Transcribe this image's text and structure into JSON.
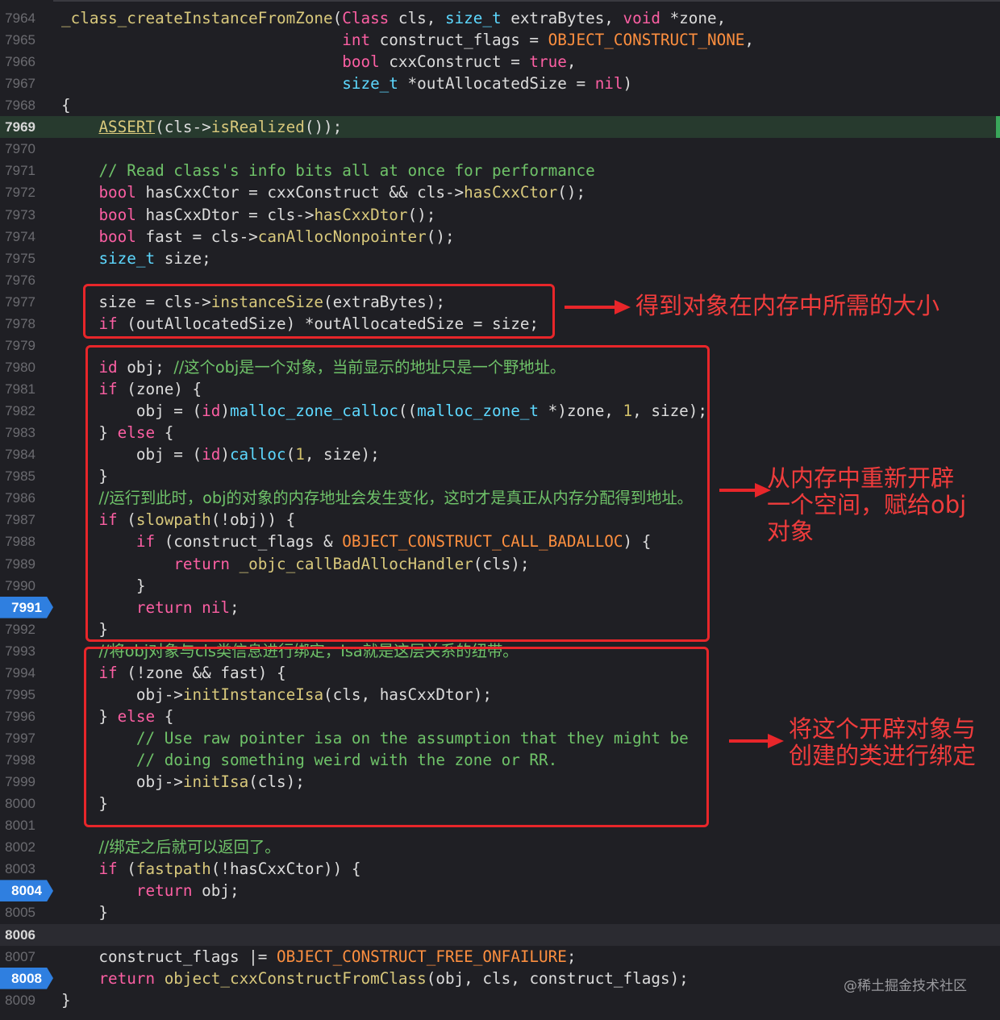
{
  "editor": {
    "lines": [
      {
        "n": "7964",
        "segs": [
          [
            "fn",
            "_class_createInstanceFromZone"
          ],
          [
            "pl",
            "("
          ],
          [
            "kw",
            "Class"
          ],
          [
            "pl",
            " cls, "
          ],
          [
            "ty",
            "size_t"
          ],
          [
            "pl",
            " extraBytes, "
          ],
          [
            "kw",
            "void"
          ],
          [
            "pl",
            " *zone,"
          ]
        ]
      },
      {
        "n": "7965",
        "segs": [
          [
            "pl",
            "                              "
          ],
          [
            "kw",
            "int"
          ],
          [
            "pl",
            " construct_flags = "
          ],
          [
            "mac",
            "OBJECT_CONSTRUCT_NONE"
          ],
          [
            "pl",
            ","
          ]
        ]
      },
      {
        "n": "7966",
        "segs": [
          [
            "pl",
            "                              "
          ],
          [
            "kw",
            "bool"
          ],
          [
            "pl",
            " cxxConstruct = "
          ],
          [
            "kw",
            "true"
          ],
          [
            "pl",
            ","
          ]
        ]
      },
      {
        "n": "7967",
        "segs": [
          [
            "pl",
            "                              "
          ],
          [
            "ty",
            "size_t"
          ],
          [
            "pl",
            " *outAllocatedSize = "
          ],
          [
            "kw",
            "nil"
          ],
          [
            "pl",
            ")"
          ]
        ]
      },
      {
        "n": "7968",
        "segs": [
          [
            "pl",
            "{"
          ]
        ]
      },
      {
        "n": "7969",
        "hl": "green",
        "cur": true,
        "segs": [
          [
            "pl",
            "    "
          ],
          [
            "fn ul",
            "ASSERT"
          ],
          [
            "pl",
            "(cls->"
          ],
          [
            "fn",
            "isRealized"
          ],
          [
            "pl",
            "());"
          ]
        ]
      },
      {
        "n": "7970",
        "segs": []
      },
      {
        "n": "7971",
        "segs": [
          [
            "pl",
            "    "
          ],
          [
            "cm",
            "// Read class's info bits all at once for performance"
          ]
        ]
      },
      {
        "n": "7972",
        "segs": [
          [
            "pl",
            "    "
          ],
          [
            "kw",
            "bool"
          ],
          [
            "pl",
            " hasCxxCtor = cxxConstruct && cls->"
          ],
          [
            "fn",
            "hasCxxCtor"
          ],
          [
            "pl",
            "();"
          ]
        ]
      },
      {
        "n": "7973",
        "segs": [
          [
            "pl",
            "    "
          ],
          [
            "kw",
            "bool"
          ],
          [
            "pl",
            " hasCxxDtor = cls->"
          ],
          [
            "fn",
            "hasCxxDtor"
          ],
          [
            "pl",
            "();"
          ]
        ]
      },
      {
        "n": "7974",
        "segs": [
          [
            "pl",
            "    "
          ],
          [
            "kw",
            "bool"
          ],
          [
            "pl",
            " fast = cls->"
          ],
          [
            "fn",
            "canAllocNonpointer"
          ],
          [
            "pl",
            "();"
          ]
        ]
      },
      {
        "n": "7975",
        "segs": [
          [
            "pl",
            "    "
          ],
          [
            "ty",
            "size_t"
          ],
          [
            "pl",
            " size;"
          ]
        ]
      },
      {
        "n": "7976",
        "segs": []
      },
      {
        "n": "7977",
        "segs": [
          [
            "pl",
            "    size = cls->"
          ],
          [
            "fn",
            "instanceSize"
          ],
          [
            "pl",
            "(extraBytes);"
          ]
        ]
      },
      {
        "n": "7978",
        "segs": [
          [
            "pl",
            "    "
          ],
          [
            "kw",
            "if"
          ],
          [
            "pl",
            " (outAllocatedSize) *outAllocatedSize = size;"
          ]
        ]
      },
      {
        "n": "7979",
        "segs": []
      },
      {
        "n": "7980",
        "segs": [
          [
            "pl",
            "    "
          ],
          [
            "kw",
            "id"
          ],
          [
            "pl",
            " obj; "
          ],
          [
            "cmc",
            "//这个obj是一个对象，当前显示的地址只是一个野地址。"
          ]
        ]
      },
      {
        "n": "7981",
        "segs": [
          [
            "pl",
            "    "
          ],
          [
            "kw",
            "if"
          ],
          [
            "pl",
            " (zone) {"
          ]
        ]
      },
      {
        "n": "7982",
        "segs": [
          [
            "pl",
            "        obj = ("
          ],
          [
            "kw",
            "id"
          ],
          [
            "pl",
            ")"
          ],
          [
            "ty",
            "malloc_zone_calloc"
          ],
          [
            "pl",
            "(("
          ],
          [
            "ty",
            "malloc_zone_t"
          ],
          [
            "pl",
            " *)zone, "
          ],
          [
            "num",
            "1"
          ],
          [
            "pl",
            ", size);"
          ]
        ]
      },
      {
        "n": "7983",
        "segs": [
          [
            "pl",
            "    } "
          ],
          [
            "kw",
            "else"
          ],
          [
            "pl",
            " {"
          ]
        ]
      },
      {
        "n": "7984",
        "segs": [
          [
            "pl",
            "        obj = ("
          ],
          [
            "kw",
            "id"
          ],
          [
            "pl",
            ")"
          ],
          [
            "ty",
            "calloc"
          ],
          [
            "pl",
            "("
          ],
          [
            "num",
            "1"
          ],
          [
            "pl",
            ", size);"
          ]
        ]
      },
      {
        "n": "7985",
        "segs": [
          [
            "pl",
            "    }"
          ]
        ]
      },
      {
        "n": "7986",
        "segs": [
          [
            "pl",
            "    "
          ],
          [
            "cmc",
            "//运行到此时，obj的对象的内存地址会发生变化，这时才是真正从内存分配得到地址。"
          ]
        ]
      },
      {
        "n": "7987",
        "segs": [
          [
            "pl",
            "    "
          ],
          [
            "kw",
            "if"
          ],
          [
            "pl",
            " ("
          ],
          [
            "fn",
            "slowpath"
          ],
          [
            "pl",
            "(!obj)) {"
          ]
        ]
      },
      {
        "n": "7988",
        "segs": [
          [
            "pl",
            "        "
          ],
          [
            "kw",
            "if"
          ],
          [
            "pl",
            " (construct_flags & "
          ],
          [
            "mac",
            "OBJECT_CONSTRUCT_CALL_BADALLOC"
          ],
          [
            "pl",
            ") {"
          ]
        ]
      },
      {
        "n": "7989",
        "segs": [
          [
            "pl",
            "            "
          ],
          [
            "kw",
            "return"
          ],
          [
            "pl",
            " "
          ],
          [
            "fn",
            "_objc_callBadAllocHandler"
          ],
          [
            "pl",
            "(cls);"
          ]
        ]
      },
      {
        "n": "7990",
        "segs": [
          [
            "pl",
            "        }"
          ]
        ]
      },
      {
        "n": "7991",
        "bp": true,
        "segs": [
          [
            "pl",
            "        "
          ],
          [
            "kw",
            "return"
          ],
          [
            "pl",
            " "
          ],
          [
            "kw",
            "nil"
          ],
          [
            "pl",
            ";"
          ]
        ]
      },
      {
        "n": "7992",
        "segs": [
          [
            "pl",
            "    }"
          ]
        ]
      },
      {
        "n": "7993",
        "segs": [
          [
            "pl",
            "    "
          ],
          [
            "cmc",
            "//将obj对象与cls类信息进行绑定，Isa就是这层关系的纽带。"
          ]
        ]
      },
      {
        "n": "7994",
        "segs": [
          [
            "pl",
            "    "
          ],
          [
            "kw",
            "if"
          ],
          [
            "pl",
            " (!zone && fast) {"
          ]
        ]
      },
      {
        "n": "7995",
        "segs": [
          [
            "pl",
            "        obj->"
          ],
          [
            "fn",
            "initInstanceIsa"
          ],
          [
            "pl",
            "(cls, hasCxxDtor);"
          ]
        ]
      },
      {
        "n": "7996",
        "segs": [
          [
            "pl",
            "    } "
          ],
          [
            "kw",
            "else"
          ],
          [
            "pl",
            " {"
          ]
        ]
      },
      {
        "n": "7997",
        "segs": [
          [
            "pl",
            "        "
          ],
          [
            "cm",
            "// Use raw pointer isa on the assumption that they might be"
          ]
        ]
      },
      {
        "n": "7998",
        "segs": [
          [
            "pl",
            "        "
          ],
          [
            "cm",
            "// doing something weird with the zone or RR."
          ]
        ]
      },
      {
        "n": "7999",
        "segs": [
          [
            "pl",
            "        obj->"
          ],
          [
            "fn",
            "initIsa"
          ],
          [
            "pl",
            "(cls);"
          ]
        ]
      },
      {
        "n": "8000",
        "segs": [
          [
            "pl",
            "    }"
          ]
        ]
      },
      {
        "n": "8001",
        "segs": []
      },
      {
        "n": "8002",
        "segs": [
          [
            "pl",
            "    "
          ],
          [
            "cmc",
            "//绑定之后就可以返回了。"
          ]
        ]
      },
      {
        "n": "8003",
        "segs": [
          [
            "pl",
            "    "
          ],
          [
            "kw",
            "if"
          ],
          [
            "pl",
            " ("
          ],
          [
            "fn",
            "fastpath"
          ],
          [
            "pl",
            "(!hasCxxCtor)) {"
          ]
        ]
      },
      {
        "n": "8004",
        "bp": true,
        "segs": [
          [
            "pl",
            "        "
          ],
          [
            "kw",
            "return"
          ],
          [
            "pl",
            " obj;"
          ]
        ]
      },
      {
        "n": "8005",
        "segs": [
          [
            "pl",
            "    }"
          ]
        ]
      },
      {
        "n": "8006",
        "hl": "gray",
        "cur": true,
        "segs": []
      },
      {
        "n": "8007",
        "segs": [
          [
            "pl",
            "    construct_flags |= "
          ],
          [
            "mac",
            "OBJECT_CONSTRUCT_FREE_ONFAILURE"
          ],
          [
            "pl",
            ";"
          ]
        ]
      },
      {
        "n": "8008",
        "bp": true,
        "segs": [
          [
            "pl",
            "    "
          ],
          [
            "kw",
            "return"
          ],
          [
            "pl",
            " "
          ],
          [
            "fn",
            "object_cxxConstructFromClass"
          ],
          [
            "pl",
            "(obj, cls, construct_flags);"
          ]
        ]
      },
      {
        "n": "8009",
        "segs": [
          [
            "pl",
            "}"
          ]
        ]
      }
    ]
  },
  "annotations": {
    "note1": "得到对象在内存中所需的大小",
    "note2": "从内存中重新开辟\n一个空间，赋给obj\n对象",
    "note3": "将这个开辟对象与\n创建的类进行绑定"
  },
  "colors": {
    "background": "#1f1f24",
    "keyword": "#fc5fa3",
    "function": "#d9c97c",
    "type": "#5dd8ff",
    "comment": "#6fc369",
    "macro": "#fd8f3f",
    "annotation": "#e8262a",
    "breakpoint": "#2f7fe0"
  },
  "watermark": "@稀土掘金技术社区"
}
